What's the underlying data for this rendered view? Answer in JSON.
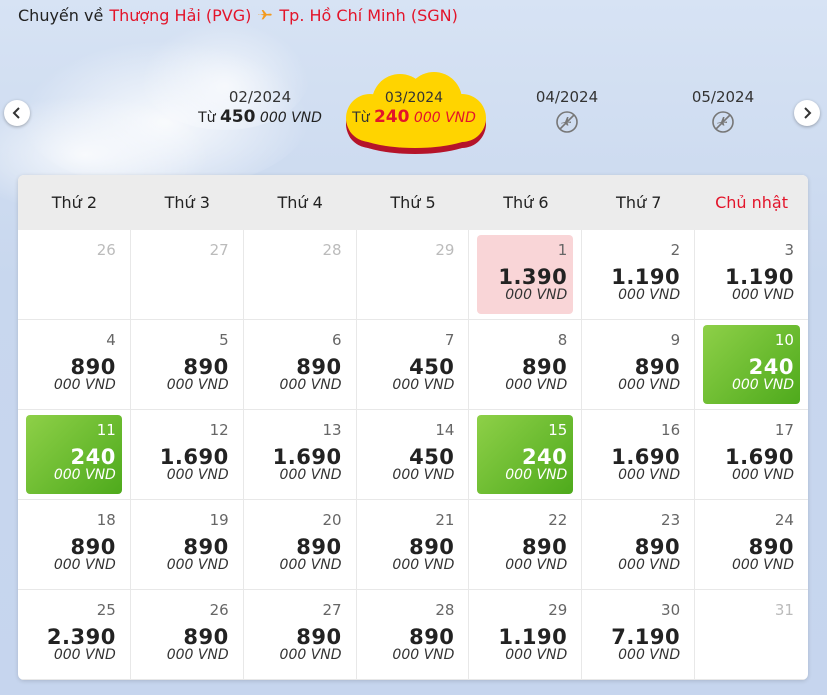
{
  "header": {
    "label": "Chuyến về",
    "origin": "Thượng Hải (PVG)",
    "destination": "Tp. Hồ Chí Minh (SGN)"
  },
  "nav": {
    "prev_icon": "chevron-left-icon",
    "next_icon": "chevron-right-icon"
  },
  "months": [
    {
      "label": "02/2024",
      "prefix": "Từ",
      "price": "450",
      "unit": "000 VND"
    },
    {
      "label": "03/2024",
      "prefix": "Từ",
      "price": "240",
      "unit": "000 VND",
      "selected": true
    },
    {
      "label": "04/2024",
      "icon": "no-flight-icon"
    },
    {
      "label": "05/2024",
      "icon": "no-flight-icon"
    }
  ],
  "weekdays": [
    "Thứ 2",
    "Thứ 3",
    "Thứ 4",
    "Thứ 5",
    "Thứ 6",
    "Thứ 7",
    "Chủ nhật"
  ],
  "unit": "000 VND",
  "days": [
    {
      "day": "26",
      "price": null,
      "style": "empty"
    },
    {
      "day": "27",
      "price": null,
      "style": "empty"
    },
    {
      "day": "28",
      "price": null,
      "style": "empty"
    },
    {
      "day": "29",
      "price": null,
      "style": "empty"
    },
    {
      "day": "1",
      "price": "1.390",
      "style": "pink"
    },
    {
      "day": "2",
      "price": "1.190",
      "style": ""
    },
    {
      "day": "3",
      "price": "1.190",
      "style": ""
    },
    {
      "day": "4",
      "price": "890",
      "style": ""
    },
    {
      "day": "5",
      "price": "890",
      "style": ""
    },
    {
      "day": "6",
      "price": "890",
      "style": ""
    },
    {
      "day": "7",
      "price": "450",
      "style": ""
    },
    {
      "day": "8",
      "price": "890",
      "style": ""
    },
    {
      "day": "9",
      "price": "890",
      "style": ""
    },
    {
      "day": "10",
      "price": "240",
      "style": "green"
    },
    {
      "day": "11",
      "price": "240",
      "style": "green"
    },
    {
      "day": "12",
      "price": "1.690",
      "style": ""
    },
    {
      "day": "13",
      "price": "1.690",
      "style": ""
    },
    {
      "day": "14",
      "price": "450",
      "style": ""
    },
    {
      "day": "15",
      "price": "240",
      "style": "green"
    },
    {
      "day": "16",
      "price": "1.690",
      "style": ""
    },
    {
      "day": "17",
      "price": "1.690",
      "style": ""
    },
    {
      "day": "18",
      "price": "890",
      "style": ""
    },
    {
      "day": "19",
      "price": "890",
      "style": ""
    },
    {
      "day": "20",
      "price": "890",
      "style": ""
    },
    {
      "day": "21",
      "price": "890",
      "style": ""
    },
    {
      "day": "22",
      "price": "890",
      "style": ""
    },
    {
      "day": "23",
      "price": "890",
      "style": ""
    },
    {
      "day": "24",
      "price": "890",
      "style": ""
    },
    {
      "day": "25",
      "price": "2.390",
      "style": ""
    },
    {
      "day": "26",
      "price": "890",
      "style": ""
    },
    {
      "day": "27",
      "price": "890",
      "style": ""
    },
    {
      "day": "28",
      "price": "890",
      "style": ""
    },
    {
      "day": "29",
      "price": "1.190",
      "style": ""
    },
    {
      "day": "30",
      "price": "7.190",
      "style": ""
    },
    {
      "day": "31",
      "price": null,
      "style": "empty"
    }
  ],
  "colors": {
    "accent_red": "#e3142a",
    "cheapest_green": "#5cb82a",
    "selected_pink": "#f9d5d7",
    "month_cloud_yellow": "#ffd400"
  }
}
